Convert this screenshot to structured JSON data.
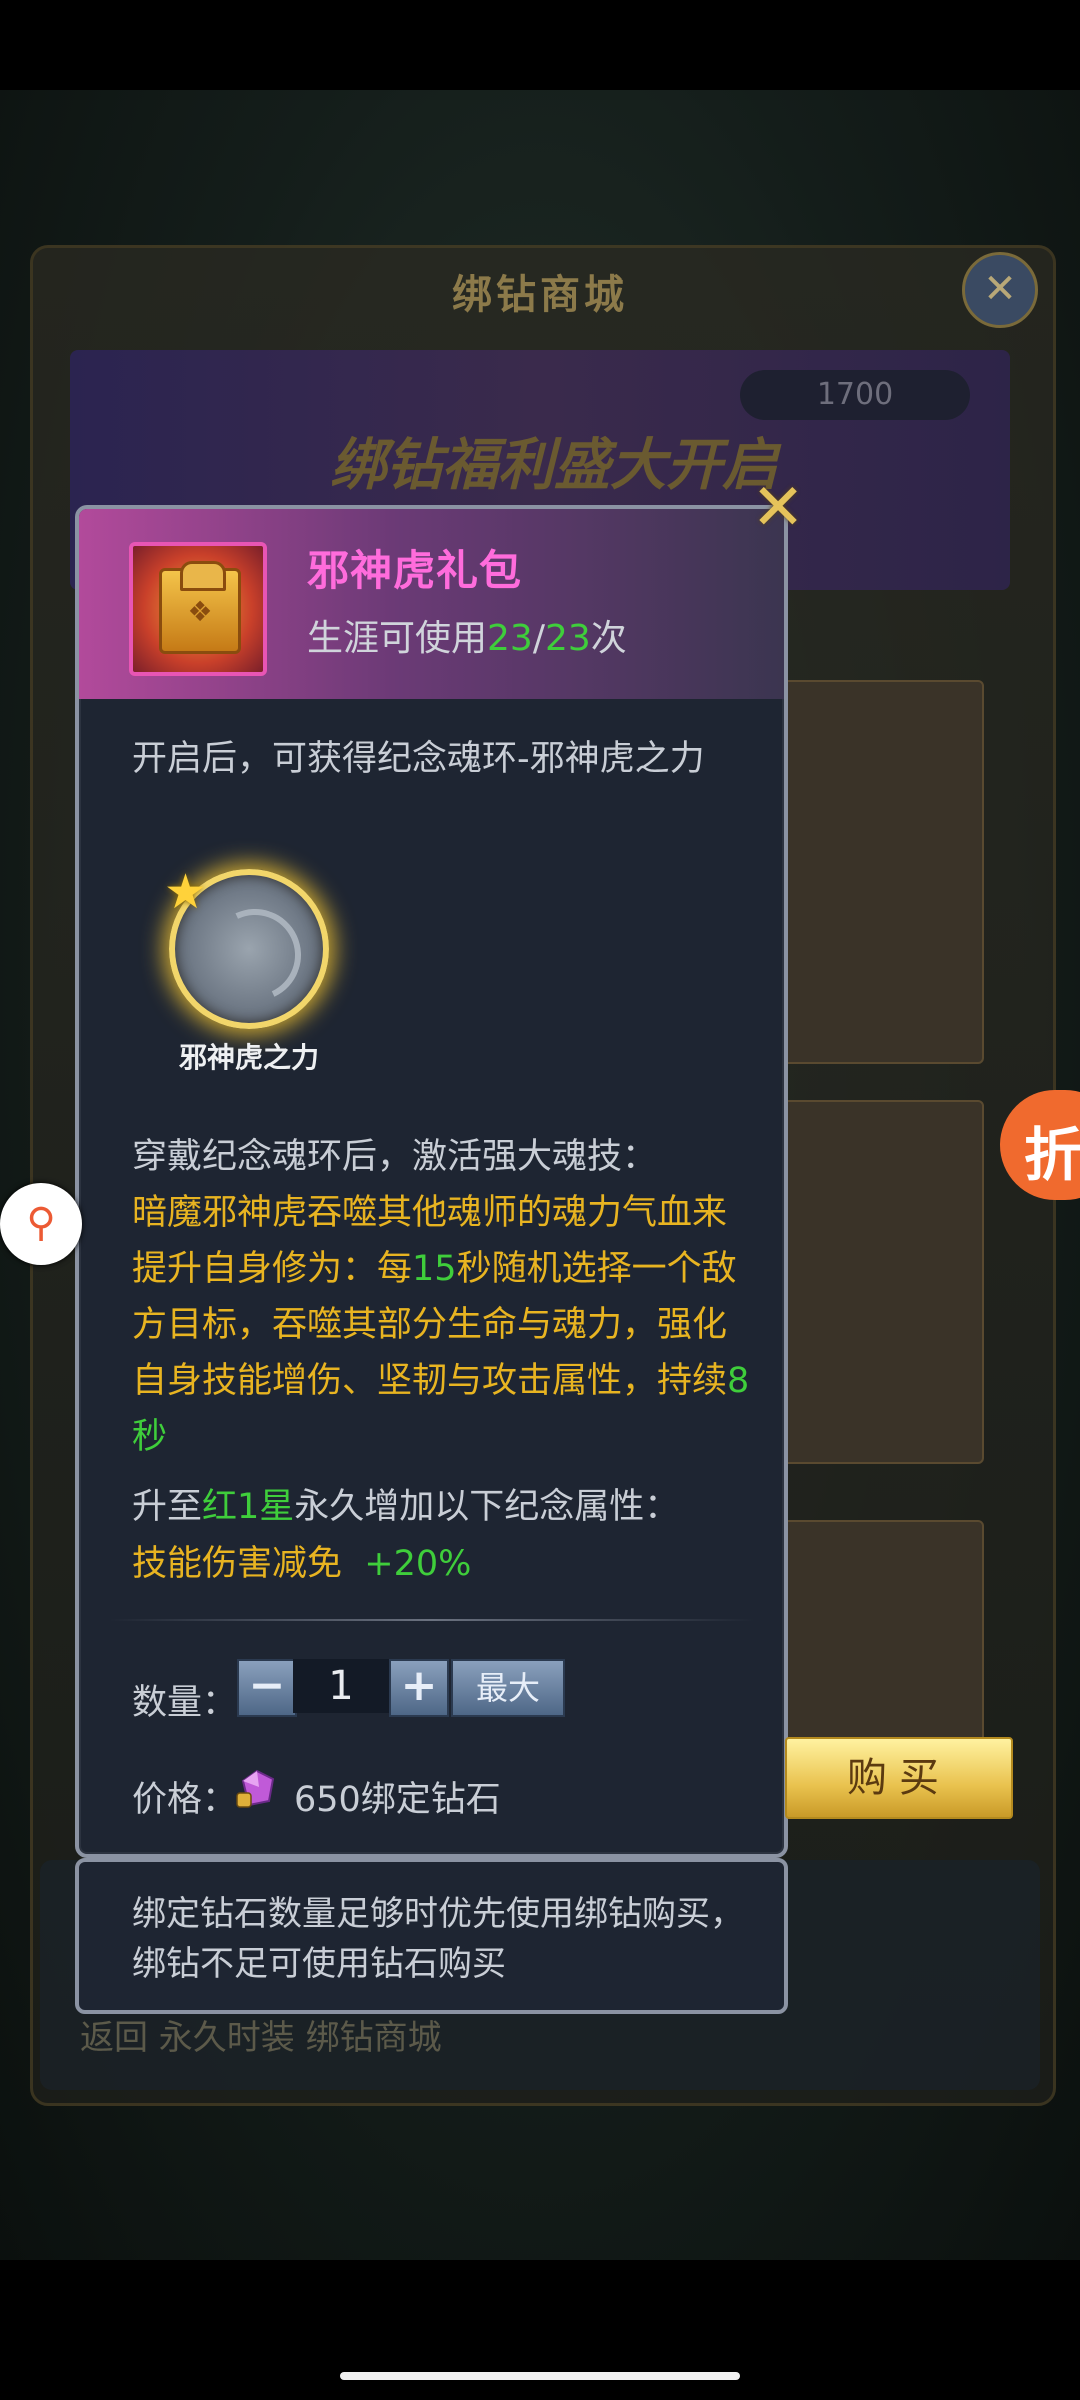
{
  "background": {
    "store_title": "绑钻商城",
    "balance": "1700",
    "banner_text": "绑钻福利盛大开启",
    "tabs": "返回   永久时装   绑钻商城"
  },
  "item": {
    "title": "邪神虎礼包",
    "usage_prefix": "生涯可使用",
    "usage_current": "23",
    "usage_sep": "/",
    "usage_total": "23",
    "usage_suffix": "次",
    "description": "开启后，可获得纪念魂环-邪神虎之力",
    "ring_name": "邪神虎之力",
    "skill_intro": "穿戴纪念魂环后，激活强大魂技：",
    "skill_effect_1": "暗魔邪神虎吞噬其他魂师的魂力气血来提升自身修为：每",
    "skill_seconds": "15",
    "skill_effect_2": "秒随机选择一个敌方目标，吞噬其部分生命与魂力，强化自身技能增伤、坚韧与攻击属性，持续",
    "skill_duration": "8秒",
    "upgrade_prefix": "升至",
    "upgrade_level": "红1星",
    "upgrade_suffix": "永久增加以下纪念属性：",
    "bonus_name": "技能伤害减免",
    "bonus_value": "+20%"
  },
  "purchase": {
    "quantity_label": "数量：",
    "minus": "−",
    "quantity": "1",
    "plus": "+",
    "max_label": "最大",
    "price_label": "价格：",
    "price_value": "650绑定钻石",
    "buy_label": "购买"
  },
  "tip": "绑定钻石数量足够时优先使用绑钻购买，绑钻不足可使用钻石购买",
  "floating": {
    "right_badge": "折"
  },
  "colors": {
    "title_pink": "#ff6cdc",
    "highlight_green": "#3fce3b",
    "effect_gold": "#e8b421"
  }
}
